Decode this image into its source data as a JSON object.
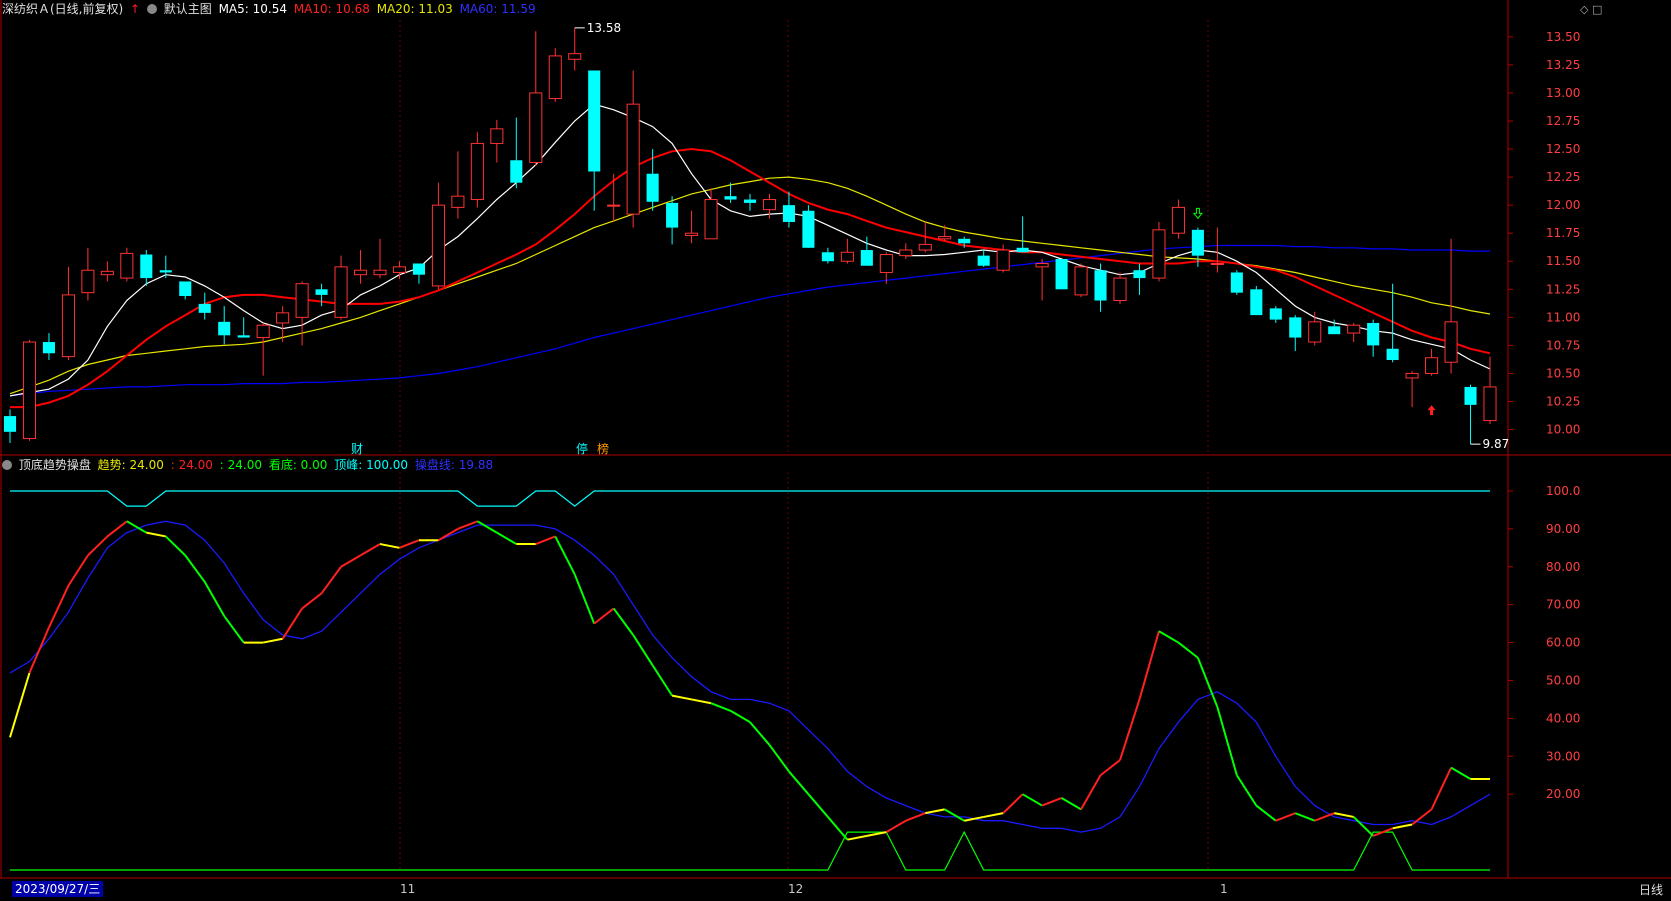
{
  "header": {
    "stock_name": "深纺织Ａ(日线,前复权)",
    "main_chart_label": "默认主图",
    "ma5_label": "MA5: 10.54",
    "ma10_label": "MA10: 10.68",
    "ma20_label": "MA20: 11.03",
    "ma60_label": "MA60: 11.59"
  },
  "indicator_header": {
    "name": "顶底趋势操盘",
    "trend1": "趋势: 24.00",
    "trend2": ": 24.00",
    "trend3": ": 24.00",
    "bottom": "看底: 0.00",
    "top": "顶峰: 100.00",
    "op_line": "操盘线: 19.88"
  },
  "footer": {
    "date_cursor": "2023/09/27/三",
    "month_labels": [
      "11",
      "12",
      "1"
    ],
    "period": "日线"
  },
  "markers": {
    "high_label": "13.58",
    "low_label": "9.87",
    "event_cai": "财",
    "event_ting": "停",
    "event_bang": "榜"
  },
  "colors": {
    "up": "#ff3232",
    "down": "#00ffff",
    "ma5": "#ffffff",
    "ma10": "#ff0000",
    "ma20": "#e6e600",
    "ma60": "#0000ff",
    "axis": "#b00000",
    "dashed_grid": "#6b0000",
    "top_line": "#00ffff",
    "bottom_line": "#00ff00"
  },
  "chart_data": [
    {
      "type": "candlestick",
      "ylim": [
        9.8,
        13.65
      ],
      "y_ticks": [
        "13.50",
        "13.25",
        "13.00",
        "12.75",
        "12.50",
        "12.25",
        "12.00",
        "11.75",
        "11.50",
        "11.25",
        "11.00",
        "10.75",
        "10.50",
        "10.25",
        "10.00"
      ],
      "candles": [
        {
          "o": 10.12,
          "h": 10.18,
          "l": 9.88,
          "c": 9.98
        },
        {
          "o": 9.92,
          "h": 10.8,
          "l": 9.9,
          "c": 10.78
        },
        {
          "o": 10.78,
          "h": 10.86,
          "l": 10.62,
          "c": 10.68
        },
        {
          "o": 10.65,
          "h": 11.45,
          "l": 10.62,
          "c": 11.2
        },
        {
          "o": 11.22,
          "h": 11.62,
          "l": 11.15,
          "c": 11.42
        },
        {
          "o": 11.38,
          "h": 11.5,
          "l": 11.32,
          "c": 11.41
        },
        {
          "o": 11.35,
          "h": 11.62,
          "l": 11.32,
          "c": 11.57
        },
        {
          "o": 11.56,
          "h": 11.6,
          "l": 11.28,
          "c": 11.35
        },
        {
          "o": 11.42,
          "h": 11.55,
          "l": 11.35,
          "c": 11.4
        },
        {
          "o": 11.32,
          "h": 11.32,
          "l": 11.16,
          "c": 11.19
        },
        {
          "o": 11.12,
          "h": 11.22,
          "l": 10.98,
          "c": 11.04
        },
        {
          "o": 10.96,
          "h": 11.1,
          "l": 10.76,
          "c": 10.84
        },
        {
          "o": 10.84,
          "h": 11.0,
          "l": 10.82,
          "c": 10.82
        },
        {
          "o": 10.82,
          "h": 10.95,
          "l": 10.48,
          "c": 10.93
        },
        {
          "o": 10.95,
          "h": 11.1,
          "l": 10.78,
          "c": 11.04
        },
        {
          "o": 11.0,
          "h": 11.32,
          "l": 10.75,
          "c": 11.3
        },
        {
          "o": 11.25,
          "h": 11.3,
          "l": 11.1,
          "c": 11.2
        },
        {
          "o": 11.0,
          "h": 11.55,
          "l": 10.98,
          "c": 11.45
        },
        {
          "o": 11.38,
          "h": 11.6,
          "l": 11.3,
          "c": 11.42
        },
        {
          "o": 11.38,
          "h": 11.7,
          "l": 11.35,
          "c": 11.42
        },
        {
          "o": 11.4,
          "h": 11.5,
          "l": 11.34,
          "c": 11.45
        },
        {
          "o": 11.48,
          "h": 11.48,
          "l": 11.3,
          "c": 11.38
        },
        {
          "o": 11.28,
          "h": 12.2,
          "l": 11.25,
          "c": 12.0
        },
        {
          "o": 11.98,
          "h": 12.48,
          "l": 11.88,
          "c": 12.08
        },
        {
          "o": 12.05,
          "h": 12.65,
          "l": 11.98,
          "c": 12.55
        },
        {
          "o": 12.55,
          "h": 12.76,
          "l": 12.38,
          "c": 12.68
        },
        {
          "o": 12.4,
          "h": 12.78,
          "l": 12.15,
          "c": 12.2
        },
        {
          "o": 12.38,
          "h": 13.55,
          "l": 12.35,
          "c": 13.0
        },
        {
          "o": 12.95,
          "h": 13.4,
          "l": 12.92,
          "c": 13.33
        },
        {
          "o": 13.3,
          "h": 13.58,
          "l": 13.2,
          "c": 13.35
        },
        {
          "o": 13.2,
          "h": 13.2,
          "l": 11.95,
          "c": 12.3
        },
        {
          "o": 12.0,
          "h": 12.28,
          "l": 11.85,
          "c": 12.0
        },
        {
          "o": 11.92,
          "h": 13.2,
          "l": 11.8,
          "c": 12.9
        },
        {
          "o": 12.28,
          "h": 12.5,
          "l": 11.95,
          "c": 12.03
        },
        {
          "o": 12.02,
          "h": 12.08,
          "l": 11.65,
          "c": 11.8
        },
        {
          "o": 11.73,
          "h": 11.95,
          "l": 11.66,
          "c": 11.75
        },
        {
          "o": 11.7,
          "h": 12.15,
          "l": 11.7,
          "c": 12.05
        },
        {
          "o": 12.08,
          "h": 12.2,
          "l": 12.02,
          "c": 12.05
        },
        {
          "o": 12.05,
          "h": 12.1,
          "l": 11.95,
          "c": 12.02
        },
        {
          "o": 11.96,
          "h": 12.1,
          "l": 11.88,
          "c": 12.05
        },
        {
          "o": 12.0,
          "h": 12.12,
          "l": 11.8,
          "c": 11.85
        },
        {
          "o": 11.95,
          "h": 12.0,
          "l": 11.62,
          "c": 11.62
        },
        {
          "o": 11.58,
          "h": 11.62,
          "l": 11.48,
          "c": 11.5
        },
        {
          "o": 11.5,
          "h": 11.7,
          "l": 11.48,
          "c": 11.58
        },
        {
          "o": 11.6,
          "h": 11.72,
          "l": 11.46,
          "c": 11.46
        },
        {
          "o": 11.4,
          "h": 11.58,
          "l": 11.3,
          "c": 11.56
        },
        {
          "o": 11.55,
          "h": 11.66,
          "l": 11.52,
          "c": 11.6
        },
        {
          "o": 11.6,
          "h": 11.85,
          "l": 11.58,
          "c": 11.65
        },
        {
          "o": 11.7,
          "h": 11.82,
          "l": 11.68,
          "c": 11.72
        },
        {
          "o": 11.7,
          "h": 11.72,
          "l": 11.62,
          "c": 11.66
        },
        {
          "o": 11.55,
          "h": 11.6,
          "l": 11.45,
          "c": 11.46
        },
        {
          "o": 11.42,
          "h": 11.65,
          "l": 11.4,
          "c": 11.6
        },
        {
          "o": 11.62,
          "h": 11.9,
          "l": 11.58,
          "c": 11.58
        },
        {
          "o": 11.45,
          "h": 11.52,
          "l": 11.15,
          "c": 11.48
        },
        {
          "o": 11.52,
          "h": 11.52,
          "l": 11.25,
          "c": 11.25
        },
        {
          "o": 11.2,
          "h": 11.48,
          "l": 11.18,
          "c": 11.45
        },
        {
          "o": 11.42,
          "h": 11.48,
          "l": 11.05,
          "c": 11.15
        },
        {
          "o": 11.15,
          "h": 11.4,
          "l": 11.12,
          "c": 11.35
        },
        {
          "o": 11.42,
          "h": 11.48,
          "l": 11.2,
          "c": 11.35
        },
        {
          "o": 11.35,
          "h": 11.85,
          "l": 11.32,
          "c": 11.78
        },
        {
          "o": 11.75,
          "h": 12.05,
          "l": 11.7,
          "c": 11.98
        },
        {
          "o": 11.78,
          "h": 11.8,
          "l": 11.45,
          "c": 11.55
        },
        {
          "o": 11.48,
          "h": 11.8,
          "l": 11.4,
          "c": 11.48
        },
        {
          "o": 11.4,
          "h": 11.42,
          "l": 11.2,
          "c": 11.22
        },
        {
          "o": 11.25,
          "h": 11.28,
          "l": 11.02,
          "c": 11.02
        },
        {
          "o": 11.08,
          "h": 11.1,
          "l": 10.95,
          "c": 10.98
        },
        {
          "o": 11.0,
          "h": 11.02,
          "l": 10.7,
          "c": 10.82
        },
        {
          "o": 10.78,
          "h": 11.05,
          "l": 10.75,
          "c": 10.96
        },
        {
          "o": 10.92,
          "h": 10.98,
          "l": 10.85,
          "c": 10.85
        },
        {
          "o": 10.86,
          "h": 10.95,
          "l": 10.78,
          "c": 10.93
        },
        {
          "o": 10.95,
          "h": 10.98,
          "l": 10.65,
          "c": 10.75
        },
        {
          "o": 10.72,
          "h": 11.3,
          "l": 10.6,
          "c": 10.62
        },
        {
          "o": 10.46,
          "h": 10.52,
          "l": 10.2,
          "c": 10.5
        },
        {
          "o": 10.5,
          "h": 10.72,
          "l": 10.48,
          "c": 10.64
        },
        {
          "o": 10.6,
          "h": 11.7,
          "l": 10.5,
          "c": 10.96
        },
        {
          "o": 10.38,
          "h": 10.4,
          "l": 9.87,
          "c": 10.22
        },
        {
          "o": 10.08,
          "h": 10.65,
          "l": 10.05,
          "c": 10.38
        }
      ],
      "ma5": [
        10.3,
        10.33,
        10.36,
        10.45,
        10.62,
        10.92,
        11.15,
        11.3,
        11.38,
        11.36,
        11.28,
        11.18,
        11.06,
        10.95,
        10.9,
        10.93,
        11.02,
        11.07,
        11.2,
        11.28,
        11.38,
        11.44,
        11.6,
        11.72,
        11.88,
        12.05,
        12.2,
        12.36,
        12.56,
        12.75,
        12.9,
        12.85,
        12.78,
        12.7,
        12.55,
        12.28,
        12.05,
        11.95,
        11.9,
        11.92,
        11.93,
        11.9,
        11.82,
        11.74,
        11.66,
        11.6,
        11.55,
        11.55,
        11.56,
        11.58,
        11.6,
        11.58,
        11.6,
        11.58,
        11.52,
        11.46,
        11.42,
        11.38,
        11.4,
        11.48,
        11.55,
        11.6,
        11.58,
        11.5,
        11.4,
        11.25,
        11.1,
        11.0,
        10.95,
        10.92,
        10.88,
        10.86,
        10.8,
        10.76,
        10.72,
        10.62,
        10.54
      ],
      "ma10": [
        10.2,
        10.2,
        10.24,
        10.3,
        10.4,
        10.52,
        10.66,
        10.8,
        10.92,
        11.02,
        11.12,
        11.18,
        11.2,
        11.2,
        11.18,
        11.16,
        11.14,
        11.12,
        11.12,
        11.12,
        11.14,
        11.18,
        11.24,
        11.32,
        11.4,
        11.48,
        11.56,
        11.65,
        11.78,
        11.92,
        12.08,
        12.22,
        12.34,
        12.42,
        12.48,
        12.5,
        12.48,
        12.4,
        12.3,
        12.2,
        12.1,
        12.02,
        11.96,
        11.92,
        11.86,
        11.8,
        11.76,
        11.72,
        11.68,
        11.64,
        11.62,
        11.6,
        11.58,
        11.58,
        11.56,
        11.54,
        11.52,
        11.5,
        11.48,
        11.48,
        11.48,
        11.5,
        11.5,
        11.48,
        11.45,
        11.42,
        11.36,
        11.28,
        11.2,
        11.12,
        11.04,
        10.96,
        10.88,
        10.82,
        10.78,
        10.72,
        10.68
      ],
      "ma20": [
        10.32,
        10.38,
        10.44,
        10.52,
        10.58,
        10.62,
        10.66,
        10.68,
        10.7,
        10.72,
        10.74,
        10.75,
        10.76,
        10.78,
        10.82,
        10.86,
        10.9,
        10.95,
        11.0,
        11.06,
        11.12,
        11.18,
        11.24,
        11.3,
        11.36,
        11.42,
        11.48,
        11.56,
        11.64,
        11.72,
        11.8,
        11.86,
        11.92,
        11.98,
        12.04,
        12.1,
        12.14,
        12.18,
        12.21,
        12.24,
        12.25,
        12.23,
        12.2,
        12.15,
        12.08,
        12.0,
        11.92,
        11.85,
        11.8,
        11.76,
        11.73,
        11.7,
        11.68,
        11.66,
        11.64,
        11.62,
        11.6,
        11.58,
        11.56,
        11.54,
        11.53,
        11.52,
        11.5,
        11.48,
        11.46,
        11.43,
        11.4,
        11.36,
        11.32,
        11.28,
        11.25,
        11.22,
        11.18,
        11.13,
        11.1,
        11.06,
        11.03
      ],
      "ma60": [
        10.3,
        10.32,
        10.34,
        10.35,
        10.36,
        10.37,
        10.38,
        10.38,
        10.39,
        10.4,
        10.4,
        10.4,
        10.41,
        10.41,
        10.41,
        10.42,
        10.42,
        10.43,
        10.44,
        10.45,
        10.46,
        10.48,
        10.5,
        10.53,
        10.56,
        10.6,
        10.64,
        10.68,
        10.72,
        10.77,
        10.82,
        10.86,
        10.9,
        10.94,
        10.98,
        11.02,
        11.06,
        11.1,
        11.14,
        11.18,
        11.21,
        11.24,
        11.27,
        11.29,
        11.31,
        11.33,
        11.35,
        11.37,
        11.39,
        11.41,
        11.43,
        11.45,
        11.47,
        11.49,
        11.51,
        11.53,
        11.55,
        11.57,
        11.59,
        11.61,
        11.62,
        11.63,
        11.64,
        11.64,
        11.64,
        11.64,
        11.63,
        11.63,
        11.62,
        11.62,
        11.61,
        11.61,
        11.6,
        11.6,
        11.6,
        11.59,
        11.59
      ]
    },
    {
      "type": "line",
      "ylim": [
        0,
        105
      ],
      "y_ticks": [
        "100.0",
        "90.00",
        "80.00",
        "70.00",
        "60.00",
        "50.00",
        "40.00",
        "30.00",
        "20.00"
      ],
      "series": [
        {
          "name": "趋势",
          "values": [
            35,
            52,
            64,
            75,
            83,
            88,
            92,
            89,
            88,
            83,
            76,
            67,
            60,
            60,
            61,
            69,
            73,
            80,
            83,
            86,
            85,
            87,
            87,
            90,
            92,
            89,
            86,
            86,
            88,
            78,
            65,
            69,
            62,
            54,
            46,
            45,
            44,
            42,
            39,
            33,
            26,
            20,
            14,
            8,
            9,
            10,
            13,
            15,
            16,
            13,
            14,
            15,
            20,
            17,
            19,
            16,
            25,
            29,
            45,
            63,
            60,
            56,
            43,
            25,
            17,
            13,
            15,
            13,
            15,
            14,
            9,
            11,
            12,
            16,
            27,
            24,
            24
          ]
        },
        {
          "name": "操盘线",
          "values": [
            52,
            55,
            61,
            68,
            77,
            85,
            89,
            91,
            92,
            91,
            87,
            81,
            73,
            66,
            62,
            61,
            63,
            68,
            73,
            78,
            82,
            85,
            87,
            89,
            91,
            91,
            91,
            91,
            90,
            87,
            83,
            78,
            70,
            62,
            56,
            51,
            47,
            45,
            45,
            44,
            42,
            37,
            32,
            26,
            22,
            19,
            17,
            15,
            14,
            14,
            13,
            13,
            12,
            11,
            11,
            10,
            11,
            14,
            22,
            32,
            39,
            45,
            47,
            44,
            39,
            30,
            22,
            17,
            14,
            13,
            12,
            12,
            13,
            12,
            14,
            17,
            20
          ]
        },
        {
          "name": "顶峰",
          "values": [
            100,
            100,
            100,
            100,
            100,
            100,
            96,
            96,
            100,
            100,
            100,
            100,
            100,
            100,
            100,
            100,
            100,
            100,
            100,
            100,
            100,
            100,
            100,
            100,
            96,
            96,
            96,
            100,
            100,
            96,
            100,
            100,
            100,
            100,
            100,
            100,
            100,
            100,
            100,
            100,
            100,
            100,
            100,
            100,
            100,
            100,
            100,
            100,
            100,
            100,
            100,
            100,
            100,
            100,
            100,
            100,
            100,
            100,
            100,
            100,
            100,
            100,
            100,
            100,
            100,
            100,
            100,
            100,
            100,
            100,
            100,
            100,
            100,
            100,
            100,
            100,
            100
          ]
        },
        {
          "name": "看底",
          "values": [
            0,
            0,
            0,
            0,
            0,
            0,
            0,
            0,
            0,
            0,
            0,
            0,
            0,
            0,
            0,
            0,
            0,
            0,
            0,
            0,
            0,
            0,
            0,
            0,
            0,
            0,
            0,
            0,
            0,
            0,
            0,
            0,
            0,
            0,
            0,
            0,
            0,
            0,
            0,
            0,
            0,
            0,
            0,
            10,
            10,
            10,
            0,
            0,
            0,
            10,
            0,
            0,
            0,
            0,
            0,
            0,
            0,
            0,
            0,
            0,
            0,
            0,
            0,
            0,
            0,
            0,
            0,
            0,
            0,
            0,
            10,
            10,
            0,
            0,
            0,
            0,
            0
          ]
        }
      ]
    }
  ]
}
